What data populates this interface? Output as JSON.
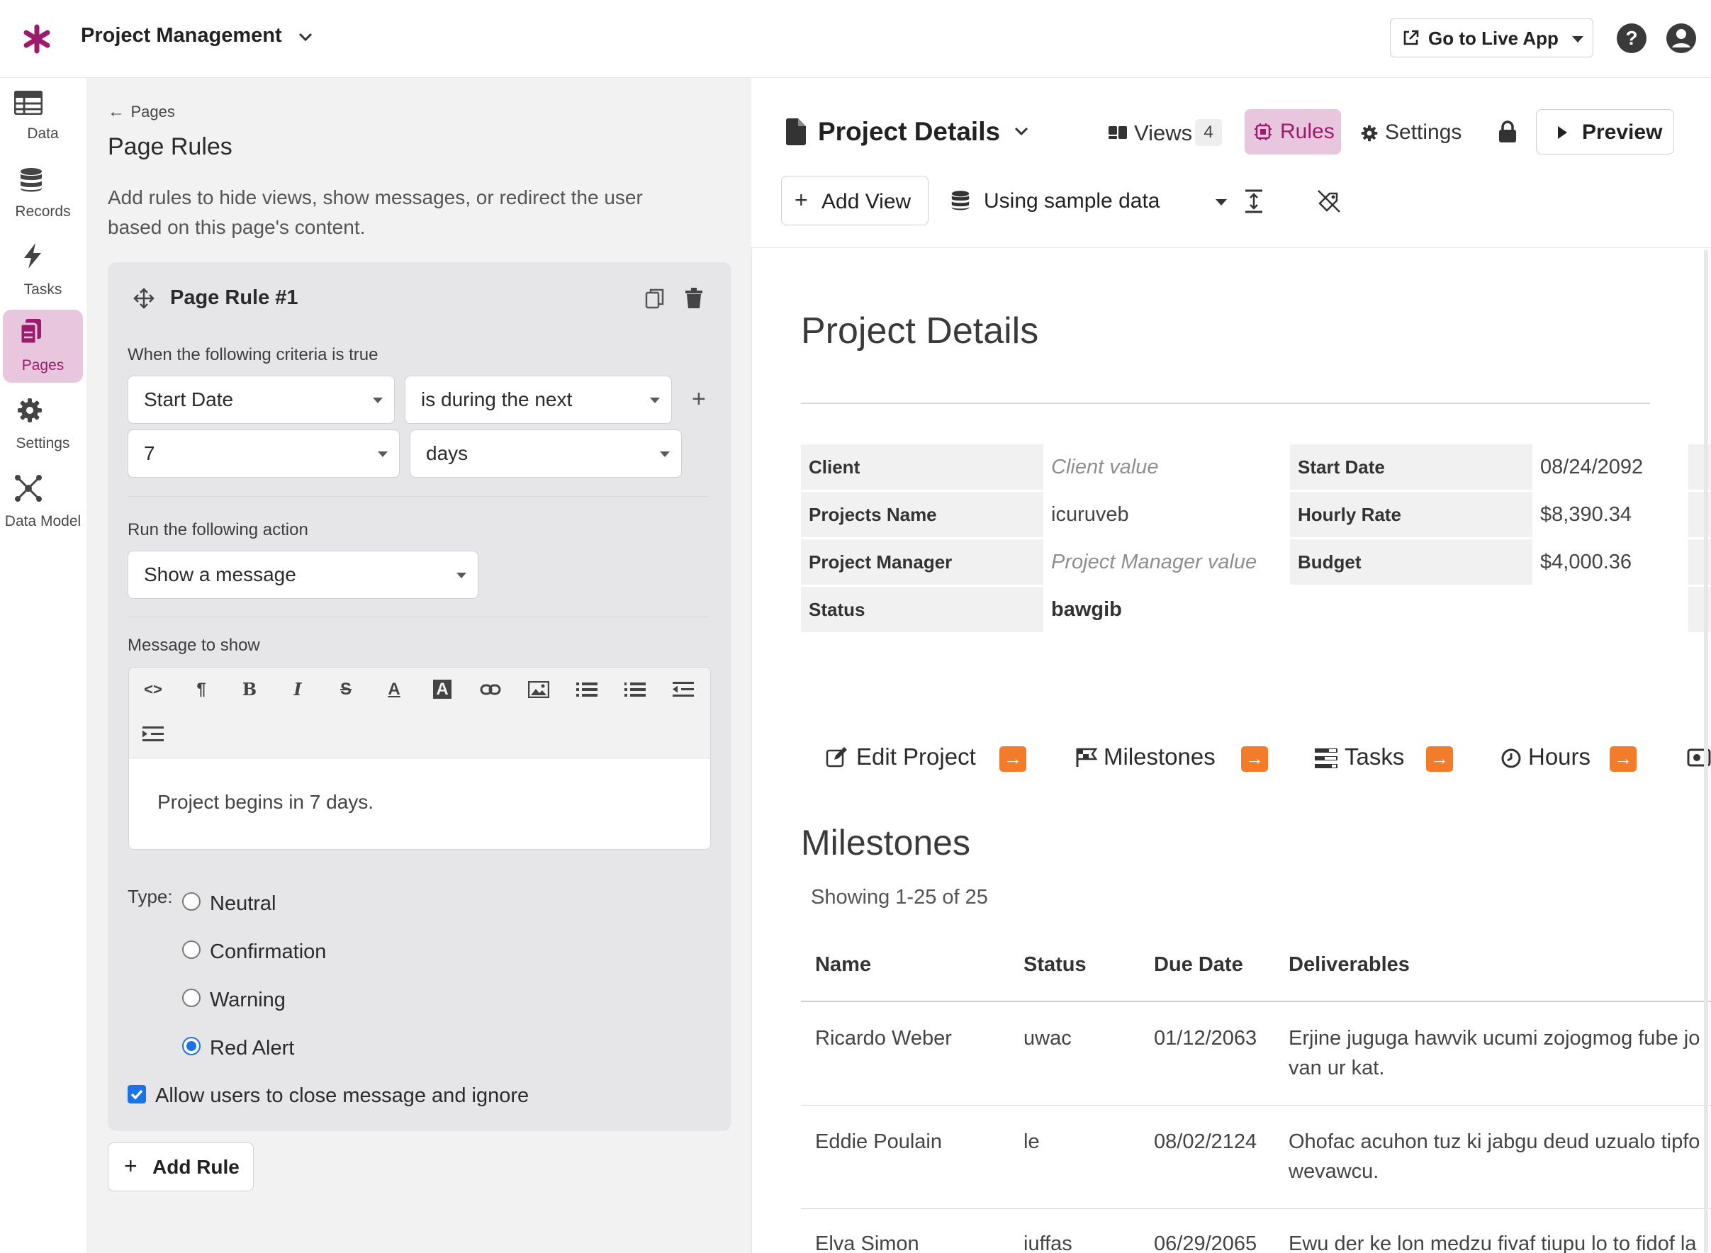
{
  "app": {
    "project_name": "Project Management",
    "live_app_label": "Go to Live App"
  },
  "nav": {
    "items": [
      {
        "label": "Data",
        "icon": "table-icon"
      },
      {
        "label": "Records",
        "icon": "database-icon"
      },
      {
        "label": "Tasks",
        "icon": "bolt-icon"
      },
      {
        "label": "Pages",
        "icon": "pages-icon",
        "active": true
      },
      {
        "label": "Settings",
        "icon": "gear-icon"
      },
      {
        "label": "Data Model",
        "icon": "graph-icon"
      }
    ]
  },
  "rules_panel": {
    "back_label": "Pages",
    "title": "Page Rules",
    "description": "Add rules to hide views, show messages, or redirect the user based on this page's content.",
    "rule": {
      "title": "Page Rule #1",
      "criteria_label": "When the following criteria is true",
      "field": "Start Date",
      "operator": "is during the next",
      "amount": "7",
      "unit": "days",
      "action_label": "Run the following action",
      "action": "Show a message",
      "message_label": "Message to show",
      "message": "Project begins in 7 days.",
      "type_label": "Type:",
      "types": [
        "Neutral",
        "Confirmation",
        "Warning",
        "Red Alert"
      ],
      "selected_type": "Red Alert",
      "allow_close_label": "Allow users to close message and ignore",
      "allow_close": true
    },
    "add_rule_label": "Add Rule"
  },
  "page_header": {
    "page_name": "Project Details",
    "views_label": "Views",
    "views_count": "4",
    "rules_label": "Rules",
    "settings_label": "Settings",
    "preview_label": "Preview",
    "add_view_label": "Add View",
    "sample_data_label": "Using sample data"
  },
  "details": {
    "heading": "Project Details",
    "left_fields": [
      {
        "label": "Client",
        "value": "Client value",
        "placeholder": true
      },
      {
        "label": "Projects Name",
        "value": "icuruveb"
      },
      {
        "label": "Project Manager",
        "value": "Project Manager value",
        "placeholder": true
      },
      {
        "label": "Status",
        "value": "bawgib",
        "bold": true
      }
    ],
    "right_fields": [
      {
        "label": "Start Date",
        "value": "08/24/2092"
      },
      {
        "label": "Hourly Rate",
        "value": "$8,390.34"
      },
      {
        "label": "Budget",
        "value": "$4,000.36"
      }
    ]
  },
  "links": [
    {
      "label": "Edit Project",
      "icon": "edit-icon"
    },
    {
      "label": "Milestones",
      "icon": "flags-icon"
    },
    {
      "label": "Tasks",
      "icon": "tasks-icon"
    },
    {
      "label": "Hours",
      "icon": "clock-icon"
    }
  ],
  "milestones": {
    "heading": "Milestones",
    "showing": "Showing 1-25 of 25",
    "columns": [
      "Name",
      "Status",
      "Due Date",
      "Deliverables"
    ],
    "rows": [
      {
        "name": "Ricardo Weber",
        "status": "uwac",
        "due": "01/12/2063",
        "deliverables_1": "Erjine juguga hawvik ucumi zojogmog fube jo",
        "deliverables_2": "van ur kat."
      },
      {
        "name": "Eddie Poulain",
        "status": "le",
        "due": "08/02/2124",
        "deliverables_1": "Ohofac acuhon tuz ki jabgu deud uzualo tipfo",
        "deliverables_2": "wevawcu."
      },
      {
        "name": "Elva Simon",
        "status": "iuffas",
        "due": "06/29/2065",
        "deliverables_1": "Ewu der ke lon medzu fivaf tiupu lo to fidof la",
        "deliverables_2": ""
      }
    ]
  },
  "colors": {
    "brand": "#9c1b6c",
    "active_nav_bg": "#e8c6de",
    "link_arrow": "#f37c2a",
    "radio_selected": "#1a73e8"
  }
}
